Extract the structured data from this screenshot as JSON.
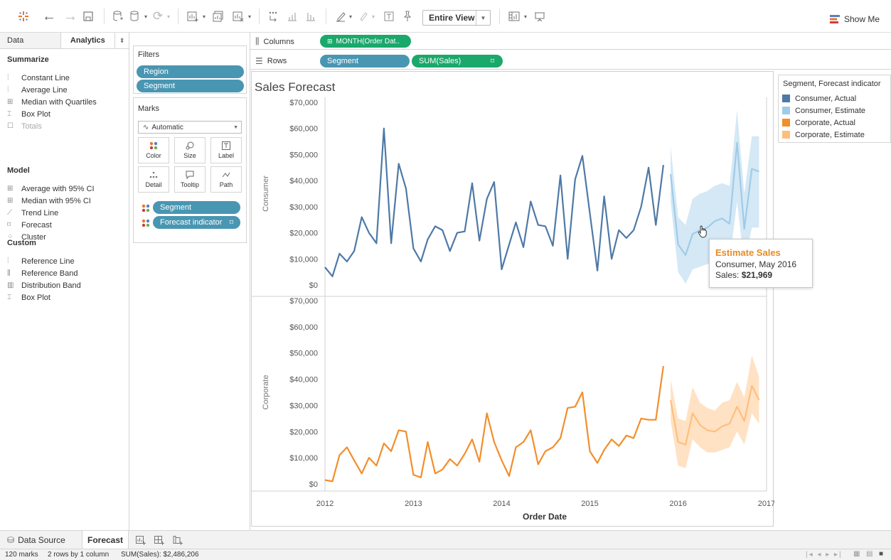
{
  "toolbar": {
    "view_mode": "Entire View",
    "show_me": "Show Me"
  },
  "left_pane": {
    "tabs": [
      "Data",
      "Analytics"
    ],
    "sections": [
      {
        "title": "Summarize",
        "items": [
          {
            "icon": "constant-line-icon",
            "label": "Constant Line",
            "disabled": false
          },
          {
            "icon": "average-line-icon",
            "label": "Average Line",
            "disabled": false
          },
          {
            "icon": "median-quartiles-icon",
            "label": "Median with Quartiles",
            "disabled": false
          },
          {
            "icon": "box-plot-icon",
            "label": "Box Plot",
            "disabled": false
          },
          {
            "icon": "totals-icon",
            "label": "Totals",
            "disabled": true
          }
        ]
      },
      {
        "title": "Model",
        "items": [
          {
            "icon": "average-ci-icon",
            "label": "Average with 95% CI",
            "disabled": false
          },
          {
            "icon": "median-ci-icon",
            "label": "Median with 95% CI",
            "disabled": false
          },
          {
            "icon": "trend-line-icon",
            "label": "Trend Line",
            "disabled": false
          },
          {
            "icon": "forecast-icon",
            "label": "Forecast",
            "disabled": false
          },
          {
            "icon": "cluster-icon",
            "label": "Cluster",
            "disabled": false
          }
        ]
      },
      {
        "title": "Custom",
        "items": [
          {
            "icon": "reference-line-icon",
            "label": "Reference Line",
            "disabled": false
          },
          {
            "icon": "reference-band-icon",
            "label": "Reference Band",
            "disabled": false
          },
          {
            "icon": "distribution-band-icon",
            "label": "Distribution Band",
            "disabled": false
          },
          {
            "icon": "box-plot-icon",
            "label": "Box Plot",
            "disabled": false
          }
        ]
      }
    ]
  },
  "filters": {
    "title": "Filters",
    "pills": [
      "Region",
      "Segment"
    ]
  },
  "marks": {
    "title": "Marks",
    "mark_type": "Automatic",
    "buttons": [
      "Color",
      "Size",
      "Label",
      "Detail",
      "Tooltip",
      "Path"
    ],
    "pills": [
      "Segment",
      "Forecast indicator"
    ]
  },
  "shelves": {
    "columns_label": "Columns",
    "columns_pill": "MONTH(Order Dat..",
    "rows_label": "Rows",
    "rows_pills": [
      "Segment",
      "SUM(Sales)"
    ]
  },
  "view": {
    "title": "Sales Forecast"
  },
  "legend": {
    "title": "Segment, Forecast indicator",
    "items": [
      {
        "label": "Consumer, Actual",
        "color": "#4e79a7"
      },
      {
        "label": "Consumer, Estimate",
        "color": "#a0cbe8"
      },
      {
        "label": "Corporate, Actual",
        "color": "#f28e2b"
      },
      {
        "label": "Corporate, Estimate",
        "color": "#ffbe7d"
      }
    ]
  },
  "tooltip": {
    "title": "Estimate Sales",
    "line1": "Consumer, May 2016",
    "line2_label": "Sales:",
    "line2_value": "$21,969"
  },
  "sheet_tabs": {
    "data_source": "Data Source",
    "active": "Forecast"
  },
  "status": {
    "marks": "120 marks",
    "rows": "2 rows by 1 column",
    "sum": "SUM(Sales): $2,486,206"
  },
  "chart_data": {
    "type": "line",
    "title": "Sales Forecast",
    "xlabel": "Order Date",
    "x_ticks": [
      "2012",
      "2013",
      "2014",
      "2015",
      "2016",
      "2017"
    ],
    "x_range": [
      "2012-01",
      "2017-01"
    ],
    "y_ticks": [
      "$0",
      "$10,000",
      "$20,000",
      "$30,000",
      "$40,000",
      "$50,000",
      "$60,000",
      "$70,000"
    ],
    "ylim": [
      0,
      70000
    ],
    "panes": [
      {
        "row_label": "Consumer",
        "actual_color": "#4e79a7",
        "estimate_color": "#a0cbe8",
        "actual": {
          "start": "2012-01",
          "values": [
            6800,
            3300,
            12000,
            9000,
            13000,
            26000,
            20000,
            16000,
            60000,
            16000,
            46500,
            37000,
            14000,
            9000,
            17500,
            22500,
            21000,
            13000,
            20000,
            20500,
            39000,
            17000,
            33000,
            39500,
            6000,
            15500,
            24000,
            14500,
            32000,
            23000,
            22500,
            15000,
            42000,
            10000,
            40500,
            49500,
            27500,
            5500,
            34000,
            10000,
            21000,
            18000,
            21000,
            30000,
            45000,
            23000,
            46000
          ]
        },
        "estimate": {
          "start": "2015-12",
          "values": [
            42500,
            15500,
            11500,
            19500,
            21000,
            21969,
            24500,
            25500,
            23500,
            54500,
            21500,
            44500,
            43500
          ],
          "lower": [
            32000,
            5000,
            500,
            6000,
            7000,
            8000,
            9000,
            10000,
            9000,
            32000,
            8000,
            22000,
            22000
          ],
          "upper": [
            53000,
            26000,
            23000,
            33000,
            35000,
            36000,
            38000,
            39000,
            38000,
            67000,
            35000,
            57000,
            57000
          ]
        }
      },
      {
        "row_label": "Corporate",
        "actual_color": "#f28e2b",
        "estimate_color": "#ffbe7d",
        "actual": {
          "start": "2012-01",
          "values": [
            1500,
            1000,
            11000,
            14000,
            9000,
            4000,
            10000,
            7000,
            15500,
            12500,
            20500,
            20000,
            3500,
            2500,
            16000,
            4000,
            5500,
            9500,
            7000,
            11500,
            17000,
            8500,
            27000,
            16000,
            9000,
            3000,
            14000,
            16000,
            20500,
            7500,
            12500,
            14000,
            17500,
            29000,
            29500,
            35000,
            12500,
            8000,
            13000,
            17000,
            14500,
            18500,
            17500,
            25000,
            24500,
            24500,
            45000
          ]
        },
        "estimate": {
          "start": "2015-12",
          "values": [
            32000,
            16000,
            15000,
            27000,
            22500,
            20500,
            20000,
            22000,
            23000,
            29500,
            24000,
            37500,
            32000
          ],
          "lower": [
            24000,
            7000,
            6000,
            17000,
            14000,
            12000,
            12000,
            13000,
            14000,
            20000,
            15000,
            27000,
            23000
          ],
          "upper": [
            40000,
            25000,
            24000,
            37000,
            31000,
            29000,
            28000,
            31000,
            32000,
            39000,
            33000,
            49000,
            41000
          ]
        }
      }
    ]
  }
}
